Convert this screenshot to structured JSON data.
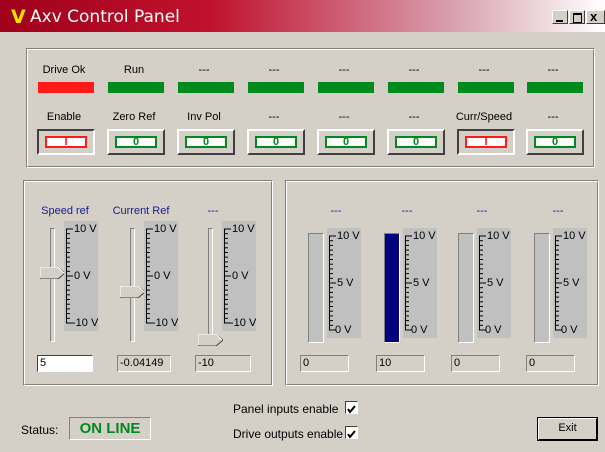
{
  "window": {
    "app_icon": "V",
    "title": "Axv Control Panel",
    "close_glyph": "x"
  },
  "indicators": [
    {
      "label": "Drive Ok",
      "color": "red"
    },
    {
      "label": "Run",
      "color": "green"
    },
    {
      "label": "---",
      "color": "green"
    },
    {
      "label": "---",
      "color": "green"
    },
    {
      "label": "---",
      "color": "green"
    },
    {
      "label": "---",
      "color": "green"
    },
    {
      "label": "---",
      "color": "green"
    },
    {
      "label": "---",
      "color": "green"
    }
  ],
  "toggles": [
    {
      "label": "Enable",
      "state": "I",
      "on": true
    },
    {
      "label": "Zero Ref",
      "state": "0",
      "on": false
    },
    {
      "label": "Inv Pol",
      "state": "0",
      "on": false
    },
    {
      "label": "---",
      "state": "0",
      "on": false
    },
    {
      "label": "---",
      "state": "0",
      "on": false
    },
    {
      "label": "---",
      "state": "0",
      "on": false
    },
    {
      "label": "Curr/Speed",
      "state": "I",
      "on": true
    },
    {
      "label": "---",
      "state": "0",
      "on": false
    }
  ],
  "inputs": {
    "labels": [
      "Speed ref",
      "Current Ref",
      "---"
    ],
    "scale_top": "10 V",
    "scale_mid": "0 V",
    "scale_bot": "-10 V",
    "slider_levels": [
      0.63,
      0.45,
      0.0
    ],
    "values": [
      "5",
      "-0.04149",
      "-10"
    ]
  },
  "outputs": {
    "labels": [
      "---",
      "---",
      "---",
      "---"
    ],
    "scale_top": "10 V",
    "scale_mid": "5 V",
    "scale_bot": "0 V",
    "levels": [
      0,
      1,
      0,
      0
    ],
    "bar_color": "#000080",
    "values": [
      "0",
      "10",
      "0",
      "0"
    ]
  },
  "status": {
    "label": "Status:",
    "value": "ON LINE"
  },
  "options": [
    {
      "label": "Panel inputs enable",
      "checked": true
    },
    {
      "label": "Drive outputs enable",
      "checked": true
    }
  ],
  "exit_label": "Exit"
}
